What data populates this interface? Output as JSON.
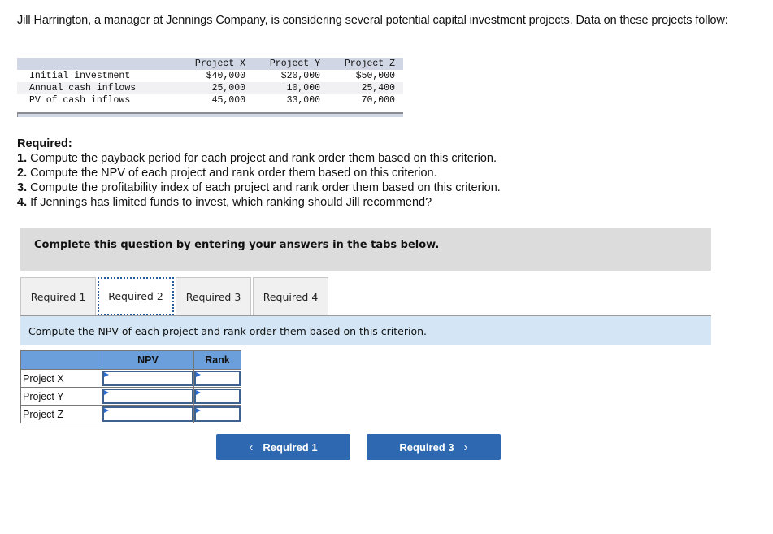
{
  "intro": "Jill Harrington, a manager at Jennings Company, is considering several potential capital investment projects. Data on these projects follow:",
  "data_table": {
    "headers": [
      "",
      "Project X",
      "Project Y",
      "Project Z"
    ],
    "rows": [
      {
        "label": "Initial investment",
        "values": [
          "$40,000",
          "$20,000",
          "$50,000"
        ]
      },
      {
        "label": "Annual cash inflows",
        "values": [
          "25,000",
          "10,000",
          "25,400"
        ]
      },
      {
        "label": "PV of cash inflows",
        "values": [
          "45,000",
          "33,000",
          "70,000"
        ]
      }
    ]
  },
  "required": {
    "heading": "Required:",
    "items": [
      {
        "num": "1.",
        "text": " Compute the payback period for each project and rank order them based on this criterion."
      },
      {
        "num": "2.",
        "text": " Compute the NPV of each project and rank order them based on this criterion."
      },
      {
        "num": "3.",
        "text": " Compute the profitability index of each project and rank order them based on this criterion."
      },
      {
        "num": "4.",
        "text": " If Jennings has limited funds to invest, which ranking should Jill recommend?"
      }
    ]
  },
  "banner": "Complete this question by entering your answers in the tabs below.",
  "tabs": [
    {
      "label": "Required 1",
      "active": false
    },
    {
      "label": "Required 2",
      "active": true
    },
    {
      "label": "Required 3",
      "active": false
    },
    {
      "label": "Required 4",
      "active": false
    }
  ],
  "instruction": "Compute the NPV of each project and rank order them based on this criterion.",
  "answer_table": {
    "headers": [
      "",
      "NPV",
      "Rank"
    ],
    "rows": [
      {
        "label": "Project X",
        "npv": "",
        "rank": ""
      },
      {
        "label": "Project Y",
        "npv": "",
        "rank": ""
      },
      {
        "label": "Project Z",
        "npv": "",
        "rank": ""
      }
    ]
  },
  "nav": {
    "prev_label": "Required 1",
    "prev_icon": "‹",
    "next_label": "Required 3",
    "next_icon": "›"
  },
  "colors": {
    "accent": "#2d68b0",
    "tab_focus": "#2a5c9c",
    "instruction_bg": "#d4e6f5",
    "table_header": "#6a9fdc"
  }
}
